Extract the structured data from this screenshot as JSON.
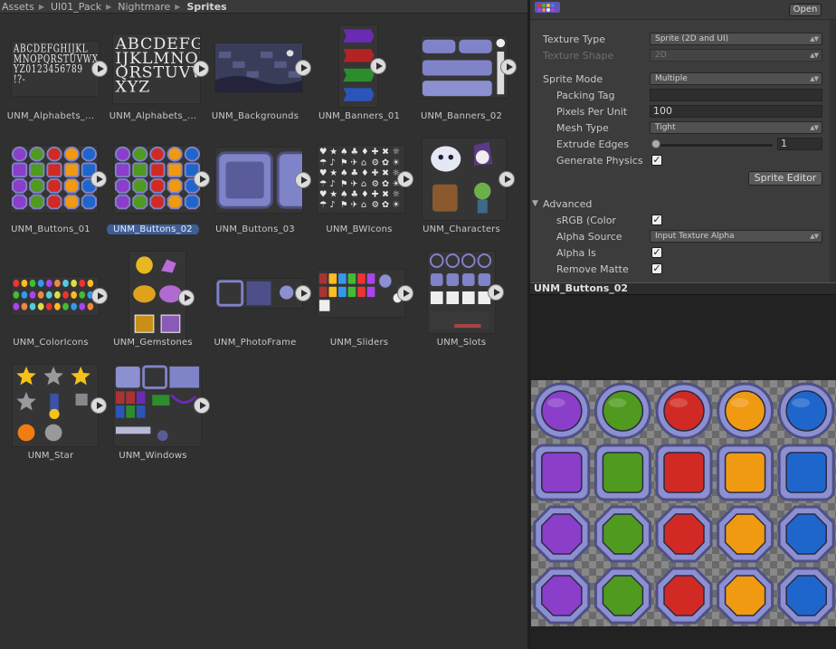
{
  "breadcrumb": [
    "Assets",
    "UI01_Pack",
    "Nightmare",
    "Sprites"
  ],
  "assets": [
    {
      "name": "UNM_Alphabets_...",
      "kind": "alphabet1"
    },
    {
      "name": "UNM_Alphabets_...",
      "kind": "alphabet2"
    },
    {
      "name": "UNM_Backgrounds",
      "kind": "backgrounds"
    },
    {
      "name": "UNM_Banners_01",
      "kind": "banners1"
    },
    {
      "name": "UNM_Banners_02",
      "kind": "banners2"
    },
    {
      "name": "UNM_Buttons_01",
      "kind": "buttons"
    },
    {
      "name": "UNM_Buttons_02",
      "kind": "buttons",
      "selected": true
    },
    {
      "name": "UNM_Buttons_03",
      "kind": "buttons3"
    },
    {
      "name": "UNM_BWIcons",
      "kind": "bwicons"
    },
    {
      "name": "UNM_Characters",
      "kind": "characters"
    },
    {
      "name": "UNM_ColorIcons",
      "kind": "coloricons"
    },
    {
      "name": "UNM_Gemstones",
      "kind": "gemstones"
    },
    {
      "name": "UNM_PhotoFrame",
      "kind": "photoframe"
    },
    {
      "name": "UNM_Sliders",
      "kind": "sliders"
    },
    {
      "name": "UNM_Slots",
      "kind": "slots"
    },
    {
      "name": "UNM_Star",
      "kind": "star"
    },
    {
      "name": "UNM_Windows",
      "kind": "windows"
    }
  ],
  "inspector": {
    "open_label": "Open",
    "texture_type": {
      "label": "Texture Type",
      "value": "Sprite (2D and UI)"
    },
    "texture_shape": {
      "label": "Texture Shape",
      "value": "2D"
    },
    "sprite_mode": {
      "label": "Sprite Mode",
      "value": "Multiple"
    },
    "packing_tag": {
      "label": "Packing Tag",
      "value": ""
    },
    "pixels_per_unit": {
      "label": "Pixels Per Unit",
      "value": "100"
    },
    "mesh_type": {
      "label": "Mesh Type",
      "value": "Tight"
    },
    "extrude_edges": {
      "label": "Extrude Edges",
      "value": "1"
    },
    "generate_physics": {
      "label": "Generate Physics",
      "checked": true
    },
    "sprite_editor_label": "Sprite Editor",
    "advanced_label": "Advanced",
    "srgb": {
      "label": "sRGB (Color",
      "checked": true
    },
    "alpha_source": {
      "label": "Alpha Source",
      "value": "Input Texture Alpha"
    },
    "alpha_is": {
      "label": "Alpha Is",
      "checked": true
    },
    "remove_matte": {
      "label": "Remove Matte",
      "checked": true
    }
  },
  "preview": {
    "title": "UNM_Buttons_02",
    "button_colors": [
      "#8a3ec9",
      "#4f9a1f",
      "#d12a24",
      "#f09a12",
      "#1f66cc"
    ]
  },
  "colors": {
    "selection": "#3e5f96",
    "frame": "#7f83c8"
  }
}
